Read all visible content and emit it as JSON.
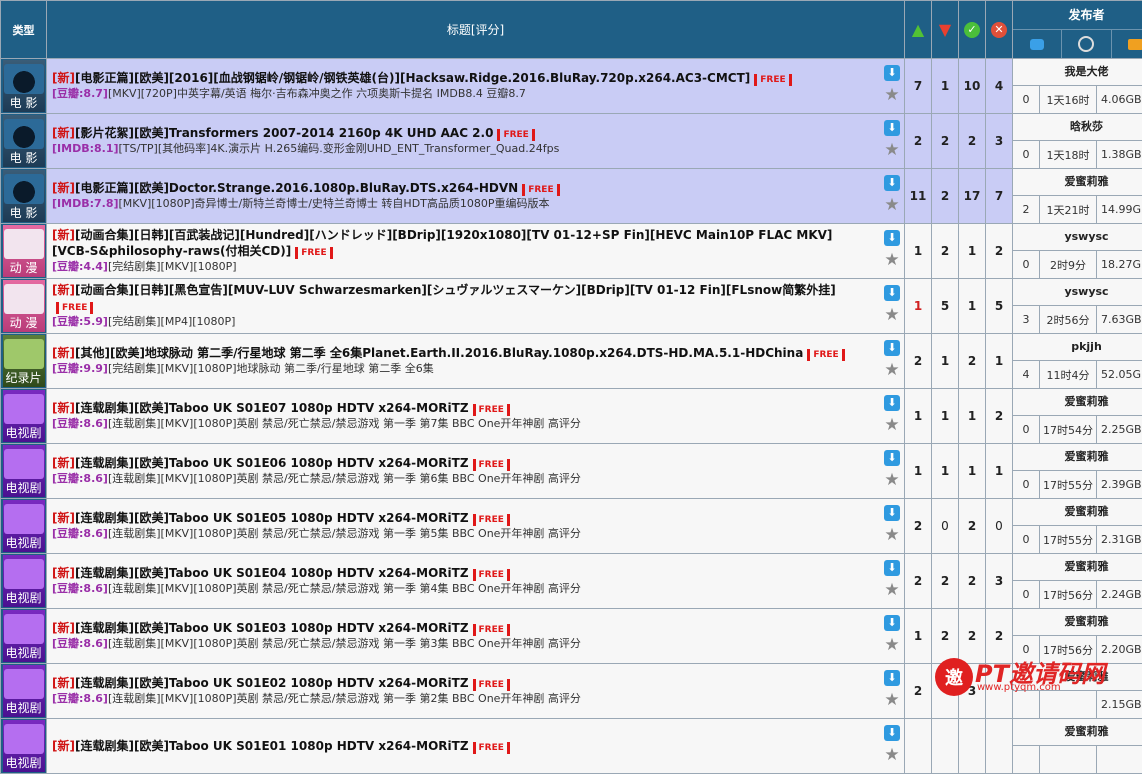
{
  "header": {
    "type_label": "类型",
    "title_label": "标题[评分]",
    "publisher_label": "发布者",
    "up_icon": "arrow-up-icon",
    "down_icon": "arrow-down-icon",
    "check_icon": "check-icon",
    "cross_icon": "cross-icon"
  },
  "colors": {
    "header_bg": "#1f5f86",
    "highlight_row": "#c9ccf5",
    "new_tag": "#d01414",
    "score": "#9a2fa8"
  },
  "rows": [
    {
      "cat": "movie",
      "cat_label": "电 影",
      "hl": true,
      "new": "[新]",
      "title": "[电影正篇][欧美][2016][血战钢锯岭/钢锯岭/钢铁英雄(台)][Hacksaw.Ridge.2016.BluRay.720p.x264.AC3-CMCT]",
      "free": "FREE",
      "score": "[豆瓣:8.7]",
      "desc": "[MKV][720P]中英字幕/英语 梅尔·吉布森冲奥之作 六项奥斯卡提名 IMDB8.4 豆瓣8.7",
      "n1": "7",
      "n2": "1",
      "n3": "10",
      "n4": "4",
      "publisher": "我是大佬",
      "s1": "0",
      "s2": "1天16时",
      "s3": "4.06GB"
    },
    {
      "cat": "movie",
      "cat_label": "电 影",
      "hl": true,
      "new": "[新]",
      "title": "[影片花絮][欧美]Transformers 2007-2014 2160p 4K UHD AAC 2.0",
      "free": "FREE",
      "score": "[IMDB:8.1]",
      "desc": "[TS/TP][其他码率]4K.演示片 H.265编码.变形金刚UHD_ENT_Transformer_Quad.24fps",
      "n1": "2",
      "n2": "2",
      "n3": "2",
      "n4": "3",
      "publisher": "晗秋莎",
      "s1": "0",
      "s2": "1天18时",
      "s3": "1.38GB"
    },
    {
      "cat": "movie",
      "cat_label": "电 影",
      "hl": true,
      "new": "[新]",
      "title": "[电影正篇][欧美]Doctor.Strange.2016.1080p.BluRay.DTS.x264-HDVN",
      "free": "FREE",
      "score": "[IMDB:7.8]",
      "desc": "[MKV][1080P]奇异博士/斯特兰奇博士/史特兰奇博士 转自HDT高品质1080P重编码版本",
      "n1": "11",
      "n2": "2",
      "n3": "17",
      "n4": "7",
      "publisher": "爱蜜莉雅",
      "s1": "2",
      "s2": "1天21时",
      "s3": "14.99GB"
    },
    {
      "cat": "anime",
      "cat_label": "动 漫",
      "hl": false,
      "new": "[新]",
      "title": "[动画合集][日韩][百武装战记][Hundred][ハンドレッド][BDrip][1920x1080][TV 01-12+SP Fin][HEVC Main10P FLAC MKV][VCB-S&philosophy-raws(付相关CD)]",
      "free": "FREE",
      "score": "[豆瓣:4.4]",
      "desc": "[完结剧集][MKV][1080P]",
      "n1": "1",
      "n2": "2",
      "n3": "1",
      "n4": "2",
      "publisher": "yswysc",
      "s1": "0",
      "s2": "2时9分",
      "s3": "18.27GB"
    },
    {
      "cat": "anime",
      "cat_label": "动 漫",
      "hl": false,
      "new": "[新]",
      "title": "[动画合集][日韩][黑色宣告][MUV-LUV Schwarzesmarken][シュヴァルツェスマーケン][BDrip][TV 01-12 Fin][FLsnow简繁外挂]",
      "free": "FREE",
      "score": "[豆瓣:5.9]",
      "desc": "[完结剧集][MP4][1080P]",
      "n1": "1",
      "n1red": true,
      "n2": "5",
      "n3": "1",
      "n4": "5",
      "publisher": "yswysc",
      "s1": "3",
      "s2": "2时56分",
      "s3": "7.63GB"
    },
    {
      "cat": "doc",
      "cat_label": "纪录片",
      "hl": false,
      "new": "[新]",
      "title": "[其他][欧美]地球脉动 第二季/行星地球 第二季 全6集Planet.Earth.II.2016.BluRay.1080p.x264.DTS-HD.MA.5.1-HDChina",
      "free": "FREE",
      "score": "[豆瓣:9.9]",
      "desc": "[完结剧集][MKV][1080P]地球脉动 第二季/行星地球 第二季 全6集",
      "n1": "2",
      "n2": "1",
      "n3": "2",
      "n4": "1",
      "publisher": "pkjjh",
      "s1": "4",
      "s2": "11时4分",
      "s3": "52.05GB"
    },
    {
      "cat": "tv",
      "cat_label": "电视剧",
      "hl": false,
      "new": "[新]",
      "title": "[连载剧集][欧美]Taboo UK S01E07 1080p HDTV x264-MORiTZ",
      "free": "FREE",
      "score": "[豆瓣:8.6]",
      "desc": "[连载剧集][MKV][1080P]英剧 禁忌/死亡禁忌/禁忌游戏 第一季 第7集 BBC One开年神剧 高评分",
      "n1": "1",
      "n2": "1",
      "n3": "1",
      "n4": "2",
      "publisher": "爱蜜莉雅",
      "s1": "0",
      "s2": "17时54分",
      "s3": "2.25GB"
    },
    {
      "cat": "tv",
      "cat_label": "电视剧",
      "hl": false,
      "new": "[新]",
      "title": "[连载剧集][欧美]Taboo UK S01E06 1080p HDTV x264-MORiTZ",
      "free": "FREE",
      "score": "[豆瓣:8.6]",
      "desc": "[连载剧集][MKV][1080P]英剧 禁忌/死亡禁忌/禁忌游戏 第一季 第6集 BBC One开年神剧 高评分",
      "n1": "1",
      "n2": "1",
      "n3": "1",
      "n4": "1",
      "publisher": "爱蜜莉雅",
      "s1": "0",
      "s2": "17时55分",
      "s3": "2.39GB"
    },
    {
      "cat": "tv",
      "cat_label": "电视剧",
      "hl": false,
      "new": "[新]",
      "title": "[连载剧集][欧美]Taboo UK S01E05 1080p HDTV x264-MORiTZ",
      "free": "FREE",
      "score": "[豆瓣:8.6]",
      "desc": "[连载剧集][MKV][1080P]英剧 禁忌/死亡禁忌/禁忌游戏 第一季 第5集 BBC One开年神剧 高评分",
      "n1": "2",
      "n2": "0",
      "n2light": true,
      "n3": "2",
      "n4": "0",
      "n4light": true,
      "publisher": "爱蜜莉雅",
      "s1": "0",
      "s2": "17时55分",
      "s3": "2.31GB"
    },
    {
      "cat": "tv",
      "cat_label": "电视剧",
      "hl": false,
      "new": "[新]",
      "title": "[连载剧集][欧美]Taboo UK S01E04 1080p HDTV x264-MORiTZ",
      "free": "FREE",
      "score": "[豆瓣:8.6]",
      "desc": "[连载剧集][MKV][1080P]英剧 禁忌/死亡禁忌/禁忌游戏 第一季 第4集 BBC One开年神剧 高评分",
      "n1": "2",
      "n2": "2",
      "n3": "2",
      "n4": "3",
      "publisher": "爱蜜莉雅",
      "s1": "0",
      "s2": "17时56分",
      "s3": "2.24GB"
    },
    {
      "cat": "tv",
      "cat_label": "电视剧",
      "hl": false,
      "new": "[新]",
      "title": "[连载剧集][欧美]Taboo UK S01E03 1080p HDTV x264-MORiTZ",
      "free": "FREE",
      "score": "[豆瓣:8.6]",
      "desc": "[连载剧集][MKV][1080P]英剧 禁忌/死亡禁忌/禁忌游戏 第一季 第3集 BBC One开年神剧 高评分",
      "n1": "1",
      "n2": "2",
      "n3": "2",
      "n4": "2",
      "publisher": "爱蜜莉雅",
      "s1": "0",
      "s2": "17时56分",
      "s3": "2.20GB"
    },
    {
      "cat": "tv",
      "cat_label": "电视剧",
      "hl": false,
      "new": "[新]",
      "title": "[连载剧集][欧美]Taboo UK S01E02 1080p HDTV x264-MORiTZ",
      "free": "FREE",
      "score": "[豆瓣:8.6]",
      "desc": "[连载剧集][MKV][1080P]英剧 禁忌/死亡禁忌/禁忌游戏 第一季 第2集 BBC One开年神剧 高评分",
      "n1": "2",
      "n2": "",
      "n3": "3",
      "n4": "",
      "publisher": "爱蜜莉雅",
      "s1": "",
      "s2": "",
      "s3": "2.15GB"
    },
    {
      "cat": "tv",
      "cat_label": "电视剧",
      "hl": false,
      "new": "[新]",
      "title": "[连载剧集][欧美]Taboo UK S01E01 1080p HDTV x264-MORiTZ",
      "free": "FREE",
      "score": "",
      "desc": "",
      "n1": "",
      "n2": "",
      "n3": "",
      "n4": "",
      "publisher": "爱蜜莉雅",
      "s1": "",
      "s2": "",
      "s3": ""
    }
  ],
  "watermark": {
    "badge": "邀",
    "text": "PT邀请码网",
    "url": "www.ptyqm.com"
  }
}
